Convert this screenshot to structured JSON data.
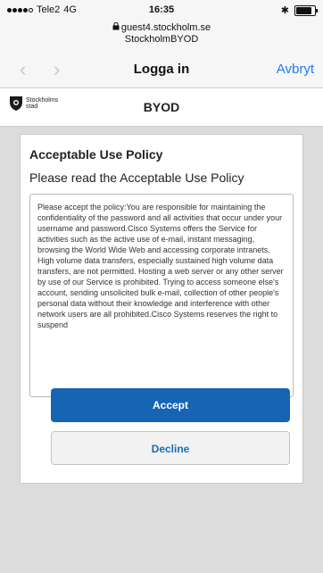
{
  "status": {
    "carrier": "Tele2",
    "network": "4G",
    "time": "16:35",
    "bluetooth_glyph": "✱",
    "battery_level": 0.85
  },
  "url": {
    "host": "guest4.stockholm.se",
    "page": "StockholmBYOD"
  },
  "nav": {
    "back_glyph": "‹",
    "forward_glyph": "›",
    "title": "Logga in",
    "cancel": "Avbryt"
  },
  "brand": {
    "logo_line1": "Stockholms",
    "logo_line2": "stad",
    "title": "BYOD"
  },
  "policy": {
    "title": "Acceptable Use Policy",
    "subtitle": "Please read the Acceptable Use Policy",
    "text": "Please accept the policy:You are responsible for maintaining the confidentiality of the password and all activities that occur under your username and password.Cisco Systems offers the Service for activities such as the active use of e-mail, instant messaging, browsing the World Wide Web and accessing corporate intranets. High volume data transfers, especially sustained high volume data transfers, are not permitted. Hosting a web server or any other server by use of our Service is prohibited. Trying to access someone else's account, sending unsolicited bulk e-mail, collection of other people's personal data without their knowledge and interference with other network users are all prohibited.Cisco Systems reserves the right to suspend"
  },
  "buttons": {
    "accept": "Accept",
    "decline": "Decline"
  },
  "colors": {
    "accent": "#1565b4",
    "link": "#1a7cf4"
  }
}
